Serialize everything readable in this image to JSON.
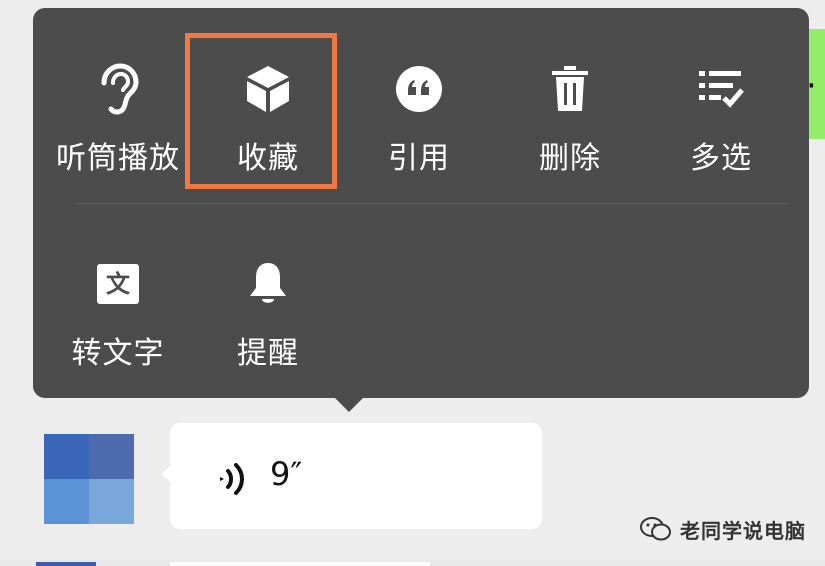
{
  "context_menu": {
    "row1": [
      {
        "label": "听筒播放",
        "icon": "ear-icon"
      },
      {
        "label": "收藏",
        "icon": "cube-icon",
        "highlighted": true
      },
      {
        "label": "引用",
        "icon": "quote-icon"
      },
      {
        "label": "删除",
        "icon": "trash-icon"
      },
      {
        "label": "多选",
        "icon": "multi-select-icon"
      }
    ],
    "row2": [
      {
        "label": "转文字",
        "icon": "text-convert-icon",
        "icon_text": "文"
      },
      {
        "label": "提醒",
        "icon": "bell-icon"
      }
    ]
  },
  "chat": {
    "voice_message": {
      "duration": "9″"
    }
  },
  "watermark": {
    "text": "老同学说电脑"
  },
  "colors": {
    "menu_bg": "#4c4c4c",
    "highlight_border": "#f07a42",
    "chat_bg": "#ededed",
    "sent_bubble": "#95ec69",
    "received_bubble": "#ffffff"
  }
}
